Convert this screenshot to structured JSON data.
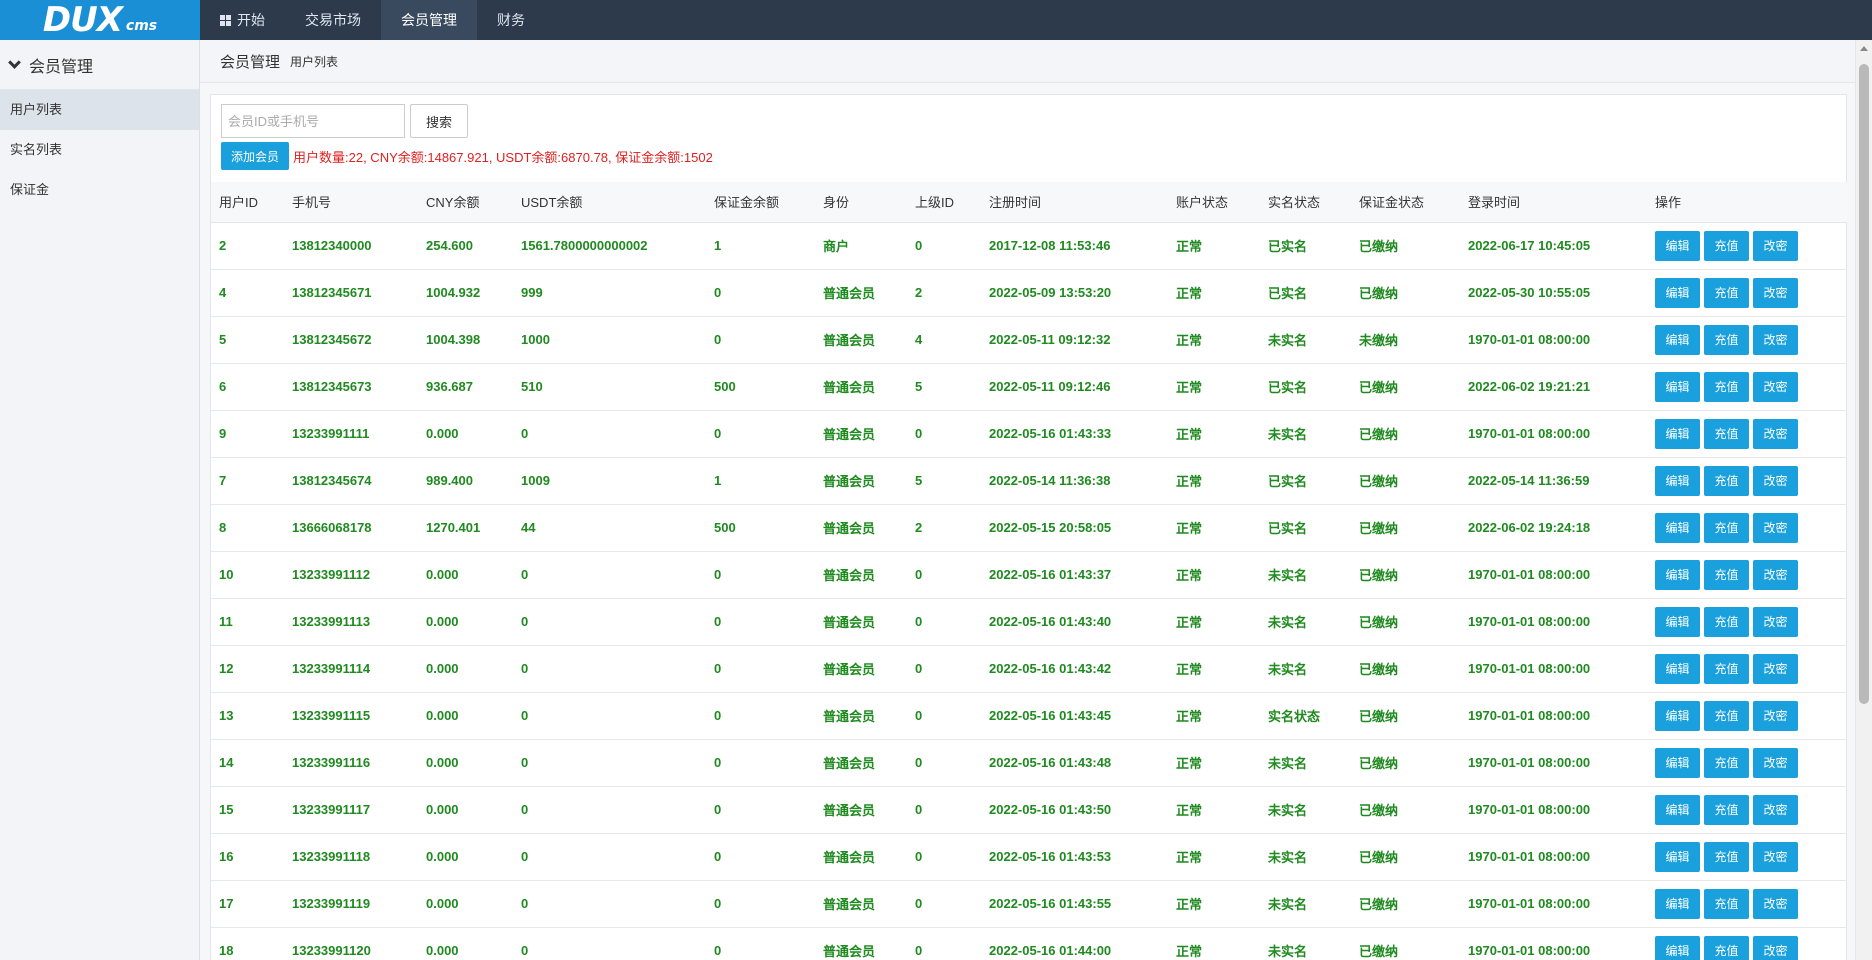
{
  "brand": {
    "main": "DUX",
    "sub": "cms",
    "color": "#1b8fd6"
  },
  "topnav": [
    {
      "label": "开始",
      "icon": "windows-icon"
    },
    {
      "label": "交易市场"
    },
    {
      "label": "会员管理",
      "active": true
    },
    {
      "label": "财务"
    }
  ],
  "sidebar": {
    "header": "会员管理",
    "items": [
      {
        "label": "用户列表",
        "active": true
      },
      {
        "label": "实名列表"
      },
      {
        "label": "保证金"
      }
    ]
  },
  "breadcrumb": {
    "title": "会员管理",
    "sub": "用户列表"
  },
  "search": {
    "placeholder": "会员ID或手机号",
    "button": "搜索"
  },
  "add_button": "添加会员",
  "summary": "用户数量:22, CNY余额:14867.921, USDT余额:6870.78, 保证金余额:1502",
  "table": {
    "headers": [
      "用户ID",
      "手机号",
      "CNY余额",
      "USDT余额",
      "保证金余额",
      "身份",
      "上级ID",
      "注册时间",
      "账户状态",
      "实名状态",
      "保证金状态",
      "登录时间",
      "操作"
    ],
    "action_labels": [
      "编辑",
      "充值",
      "改密"
    ],
    "rows": [
      [
        "2",
        "13812340000",
        "254.600",
        "1561.7800000000002",
        "1",
        "商户",
        "0",
        "2017-12-08 11:53:46",
        "正常",
        "已实名",
        "已缴纳",
        "2022-06-17 10:45:05"
      ],
      [
        "4",
        "13812345671",
        "1004.932",
        "999",
        "0",
        "普通会员",
        "2",
        "2022-05-09 13:53:20",
        "正常",
        "已实名",
        "已缴纳",
        "2022-05-30 10:55:05"
      ],
      [
        "5",
        "13812345672",
        "1004.398",
        "1000",
        "0",
        "普通会员",
        "4",
        "2022-05-11 09:12:32",
        "正常",
        "未实名",
        "未缴纳",
        "1970-01-01 08:00:00"
      ],
      [
        "6",
        "13812345673",
        "936.687",
        "510",
        "500",
        "普通会员",
        "5",
        "2022-05-11 09:12:46",
        "正常",
        "已实名",
        "已缴纳",
        "2022-06-02 19:21:21"
      ],
      [
        "9",
        "13233991111",
        "0.000",
        "0",
        "0",
        "普通会员",
        "0",
        "2022-05-16 01:43:33",
        "正常",
        "未实名",
        "已缴纳",
        "1970-01-01 08:00:00"
      ],
      [
        "7",
        "13812345674",
        "989.400",
        "1009",
        "1",
        "普通会员",
        "5",
        "2022-05-14 11:36:38",
        "正常",
        "已实名",
        "已缴纳",
        "2022-05-14 11:36:59"
      ],
      [
        "8",
        "13666068178",
        "1270.401",
        "44",
        "500",
        "普通会员",
        "2",
        "2022-05-15 20:58:05",
        "正常",
        "已实名",
        "已缴纳",
        "2022-06-02 19:24:18"
      ],
      [
        "10",
        "13233991112",
        "0.000",
        "0",
        "0",
        "普通会员",
        "0",
        "2022-05-16 01:43:37",
        "正常",
        "未实名",
        "已缴纳",
        "1970-01-01 08:00:00"
      ],
      [
        "11",
        "13233991113",
        "0.000",
        "0",
        "0",
        "普通会员",
        "0",
        "2022-05-16 01:43:40",
        "正常",
        "未实名",
        "已缴纳",
        "1970-01-01 08:00:00"
      ],
      [
        "12",
        "13233991114",
        "0.000",
        "0",
        "0",
        "普通会员",
        "0",
        "2022-05-16 01:43:42",
        "正常",
        "未实名",
        "已缴纳",
        "1970-01-01 08:00:00"
      ],
      [
        "13",
        "13233991115",
        "0.000",
        "0",
        "0",
        "普通会员",
        "0",
        "2022-05-16 01:43:45",
        "正常",
        "实名状态",
        "已缴纳",
        "1970-01-01 08:00:00"
      ],
      [
        "14",
        "13233991116",
        "0.000",
        "0",
        "0",
        "普通会员",
        "0",
        "2022-05-16 01:43:48",
        "正常",
        "未实名",
        "已缴纳",
        "1970-01-01 08:00:00"
      ],
      [
        "15",
        "13233991117",
        "0.000",
        "0",
        "0",
        "普通会员",
        "0",
        "2022-05-16 01:43:50",
        "正常",
        "未实名",
        "已缴纳",
        "1970-01-01 08:00:00"
      ],
      [
        "16",
        "13233991118",
        "0.000",
        "0",
        "0",
        "普通会员",
        "0",
        "2022-05-16 01:43:53",
        "正常",
        "未实名",
        "已缴纳",
        "1970-01-01 08:00:00"
      ],
      [
        "17",
        "13233991119",
        "0.000",
        "0",
        "0",
        "普通会员",
        "0",
        "2022-05-16 01:43:55",
        "正常",
        "未实名",
        "已缴纳",
        "1970-01-01 08:00:00"
      ],
      [
        "18",
        "13233991120",
        "0.000",
        "0",
        "0",
        "普通会员",
        "0",
        "2022-05-16 01:44:00",
        "正常",
        "未实名",
        "已缴纳",
        "1970-01-01 08:00:00"
      ]
    ]
  },
  "colors": {
    "accent": "#1aa0dc",
    "topbar": "#2c3a4b",
    "row_text": "#1f8a1f",
    "summary": "#e02020"
  }
}
